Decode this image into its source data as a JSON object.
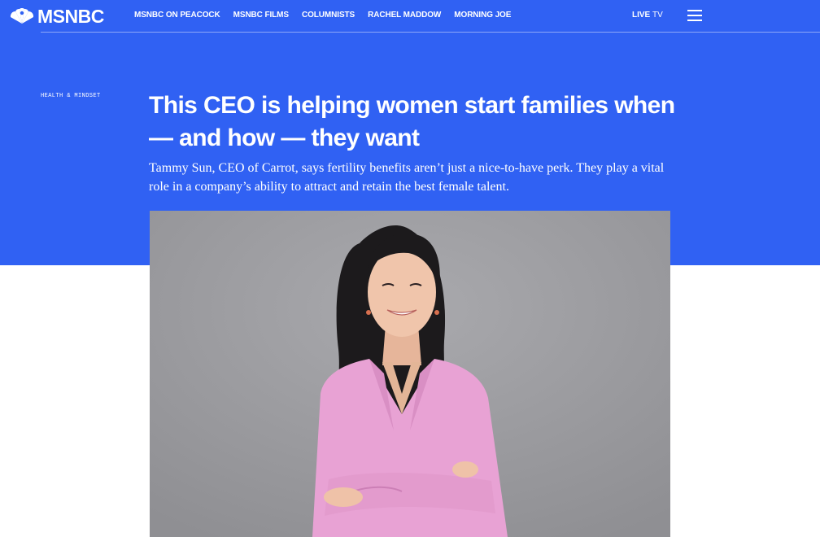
{
  "brand": {
    "logo_text": "MSNBC",
    "accent": "#3061f3"
  },
  "nav": {
    "links": [
      "MSNBC ON PEACOCK",
      "MSNBC FILMS",
      "COLUMNISTS",
      "RACHEL MADDOW",
      "MORNING JOE"
    ],
    "live_label": "LIVE",
    "live_tv_label": "TV",
    "menu_icon": "hamburger-menu-icon"
  },
  "article": {
    "category": "HEALTH & MINDSET",
    "headline": "This CEO is helping women start families when — and how — they want",
    "dek": "Tammy Sun, CEO of Carrot, says fertility benefits aren’t just a nice-to-have perk. They play a vital role in a company’s ability to attract and retain the best female talent."
  }
}
